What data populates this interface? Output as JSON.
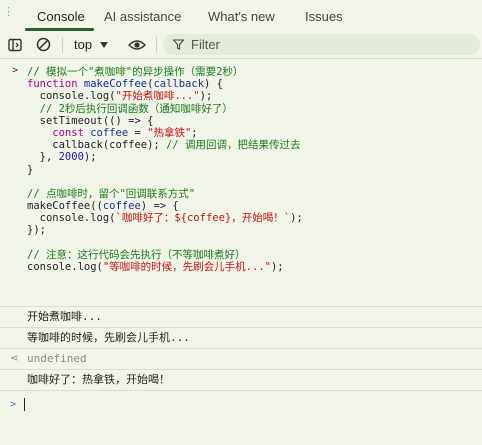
{
  "tabs": [
    {
      "label": "Console"
    },
    {
      "label": "AI assistance"
    },
    {
      "label": "What's new"
    },
    {
      "label": "Issues"
    }
  ],
  "toolbar": {
    "context": "top",
    "filter_placeholder": "Filter"
  },
  "code_block_1": {
    "lines": [
      [
        {
          "c": "c-comment",
          "t": "// 模拟一个\"煮咖啡\"的异步操作（需要2秒）"
        }
      ],
      [
        {
          "c": "c-kw",
          "t": "function "
        },
        {
          "c": "c-fn",
          "t": "makeCoffee"
        },
        {
          "c": "c-plain",
          "t": "("
        },
        {
          "c": "c-var",
          "t": "callback"
        },
        {
          "c": "c-plain",
          "t": ") {"
        }
      ],
      [
        {
          "c": "c-plain",
          "t": "  console.log("
        },
        {
          "c": "c-str",
          "t": "\"开始煮咖啡...\""
        },
        {
          "c": "c-plain",
          "t": ");"
        }
      ],
      [
        {
          "c": "c-comment",
          "t": "  // 2秒后执行回调函数（通知咖啡好了）"
        }
      ],
      [
        {
          "c": "c-plain",
          "t": "  setTimeout(() => {"
        }
      ],
      [
        {
          "c": "c-kw",
          "t": "    const "
        },
        {
          "c": "c-var",
          "t": "coffee"
        },
        {
          "c": "c-plain",
          "t": " = "
        },
        {
          "c": "c-str",
          "t": "\"热拿铁\""
        },
        {
          "c": "c-plain",
          "t": ";"
        }
      ],
      [
        {
          "c": "c-plain",
          "t": "    callback(coffee); "
        },
        {
          "c": "c-comment",
          "t": "// 调用回调，把结果传过去"
        }
      ],
      [
        {
          "c": "c-plain",
          "t": "  }, "
        },
        {
          "c": "c-num",
          "t": "2000"
        },
        {
          "c": "c-plain",
          "t": ");"
        }
      ],
      [
        {
          "c": "c-plain",
          "t": "}"
        }
      ],
      [
        {
          "c": "c-plain",
          "t": ""
        }
      ],
      [
        {
          "c": "c-comment",
          "t": "// 点咖啡时，留个\"回调联系方式\""
        }
      ],
      [
        {
          "c": "c-plain",
          "t": "makeCoffee(("
        },
        {
          "c": "c-var",
          "t": "coffee"
        },
        {
          "c": "c-plain",
          "t": ") => {"
        }
      ],
      [
        {
          "c": "c-plain",
          "t": "  console.log("
        },
        {
          "c": "c-str",
          "t": "`咖啡好了：${coffee}，开始喝！`"
        },
        {
          "c": "c-plain",
          "t": ");"
        }
      ],
      [
        {
          "c": "c-plain",
          "t": "});"
        }
      ],
      [
        {
          "c": "c-plain",
          "t": ""
        }
      ],
      [
        {
          "c": "c-comment",
          "t": "// 注意：这行代码会先执行（不等咖啡煮好）"
        }
      ],
      [
        {
          "c": "c-plain",
          "t": "console.log("
        },
        {
          "c": "c-str",
          "t": "\"等咖啡的时候，先刷会儿手机...\""
        },
        {
          "c": "c-plain",
          "t": ");"
        }
      ]
    ]
  },
  "outputs": {
    "log1": "开始煮咖啡...",
    "log2": "等咖啡的时候，先刷会儿手机...",
    "return_value": "undefined",
    "log3": "咖啡好了：热拿铁，开始喝！"
  },
  "colors": {
    "background": "#f1f5e9",
    "active_tab_underline": "#2f5f2f"
  }
}
